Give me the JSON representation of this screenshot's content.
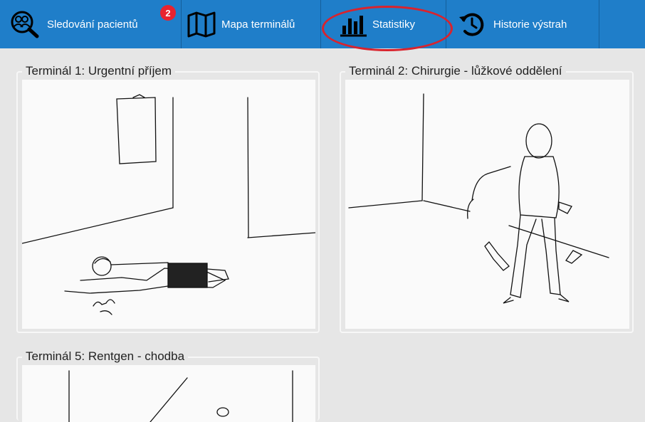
{
  "toolbar": {
    "tabs": [
      {
        "label": "Sledování pacientů",
        "icon": "patient-search-icon",
        "badge": "2"
      },
      {
        "label": "Mapa terminálů",
        "icon": "map-icon"
      },
      {
        "label": "Statistiky",
        "icon": "bar-chart-icon"
      },
      {
        "label": "Historie výstrah",
        "icon": "history-icon"
      }
    ],
    "accent": "#1f7ec9",
    "badge_color": "#e8232f",
    "highlight_color": "#d9232d"
  },
  "terminals": [
    {
      "title": "Terminál 1: Urgentní příjem"
    },
    {
      "title": "Terminál 2: Chirurgie - lůžkové oddělení"
    },
    {
      "title": "Terminál 5: Rentgen - chodba"
    }
  ]
}
